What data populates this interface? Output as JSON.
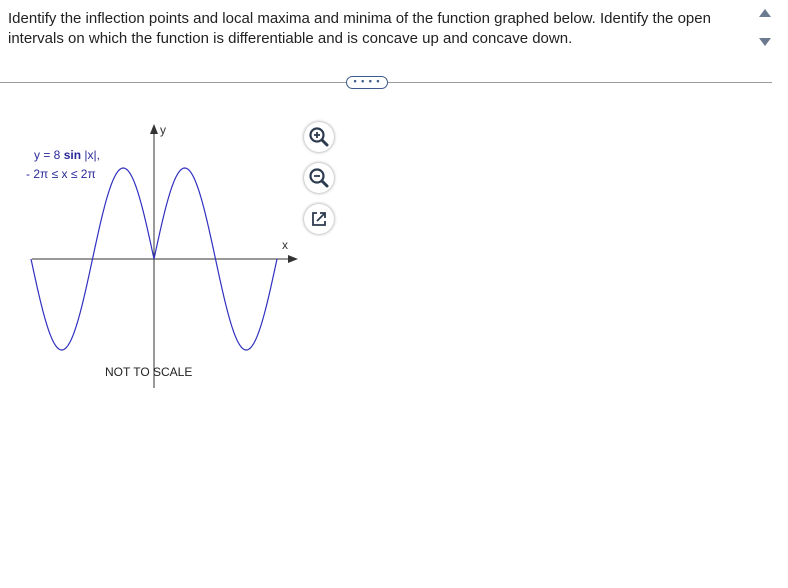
{
  "question": {
    "text": "Identify the inflection points and local maxima and minima of the function graphed below. Identify the open intervals on which the function is differentiable and is concave up and concave down."
  },
  "more_button": {
    "label": "• • • •"
  },
  "graph": {
    "equation_prefix": "y = 8 ",
    "equation_fn": "sin",
    "equation_suffix": " |x|,",
    "domain_text": "- 2π ≤ x ≤ 2π",
    "y_axis_label": "y",
    "x_axis_label": "x",
    "note": "NOT TO SCALE",
    "curve_color": "#3030c0"
  },
  "tools": {
    "zoom_in": "zoom-in-icon",
    "zoom_out": "zoom-out-icon",
    "popout": "popout-icon"
  }
}
